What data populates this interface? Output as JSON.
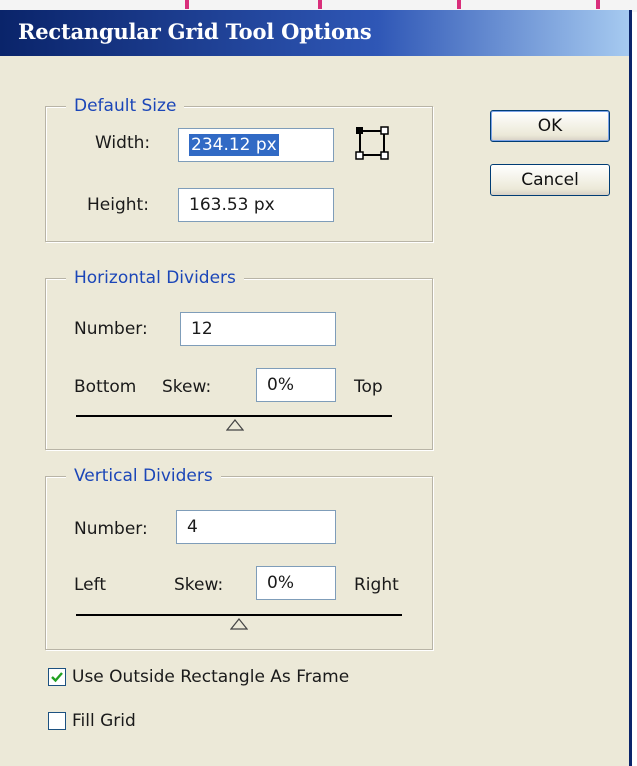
{
  "dialog": {
    "title": "Rectangular Grid Tool Options",
    "ok_label": "OK",
    "cancel_label": "Cancel"
  },
  "default_size": {
    "legend": "Default Size",
    "width_label": "Width:",
    "width_value": "234.12 px",
    "height_label": "Height:",
    "height_value": "163.53 px",
    "constrain_icon": "constrain-proportions-icon"
  },
  "horizontal_dividers": {
    "legend": "Horizontal Dividers",
    "number_label": "Number:",
    "number_value": "12",
    "left_end_label": "Bottom",
    "skew_label": "Skew:",
    "skew_value": "0%",
    "right_end_label": "Top",
    "skew_slider_value": 0
  },
  "vertical_dividers": {
    "legend": "Vertical Dividers",
    "number_label": "Number:",
    "number_value": "4",
    "left_end_label": "Left",
    "skew_label": "Skew:",
    "skew_value": "0%",
    "right_end_label": "Right",
    "skew_slider_value": 0
  },
  "options": {
    "use_outside_rectangle": {
      "label": "Use Outside Rectangle As Frame",
      "checked": true
    },
    "fill_grid": {
      "label": "Fill Grid",
      "checked": false
    }
  },
  "colors": {
    "title_gradient_start": "#0a246a",
    "dialog_bg": "#ece9d8",
    "legend_text": "#1b46b8",
    "selection": "#316ac5"
  }
}
